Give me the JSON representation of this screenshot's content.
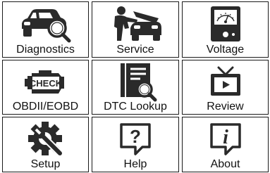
{
  "menu": {
    "items": [
      {
        "label": "Diagnostics",
        "icon": "car-magnifier-icon"
      },
      {
        "label": "Service",
        "icon": "mechanic-icon"
      },
      {
        "label": "Voltage",
        "icon": "voltmeter-icon"
      },
      {
        "label": "OBDII/EOBD",
        "icon": "check-engine-icon"
      },
      {
        "label": "DTC Lookup",
        "icon": "document-magnifier-icon"
      },
      {
        "label": "Review",
        "icon": "tv-play-icon"
      },
      {
        "label": "Setup",
        "icon": "gear-wrench-icon"
      },
      {
        "label": "Help",
        "icon": "question-icon"
      },
      {
        "label": "About",
        "icon": "info-icon"
      }
    ]
  },
  "icons": {
    "check_text": "CHECK",
    "help_glyph": "?",
    "about_glyph": "i"
  },
  "colors": {
    "icon": "#2a2a2a",
    "border": "#1a1a1a",
    "background": "#ffffff"
  }
}
